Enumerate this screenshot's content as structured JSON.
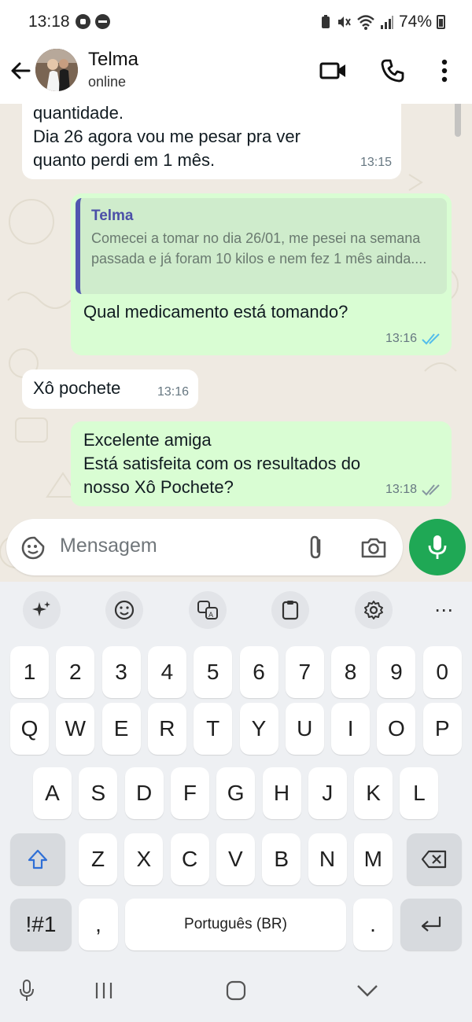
{
  "status_bar": {
    "time": "13:18",
    "battery": "74%"
  },
  "header": {
    "contact_name": "Telma",
    "contact_status": "online"
  },
  "messages": [
    {
      "direction": "in",
      "text": "quantidade.\nDia 26 agora vou me pesar pra ver\nquanto perdi em 1 mês.",
      "time": "13:15"
    },
    {
      "direction": "out",
      "quoted": {
        "name": "Telma",
        "text": "Comecei a tomar no dia 26/01, me pesei na semana passada e já foram 10 kilos e nem fez 1 mês ainda...."
      },
      "text": "Qual medicamento está tomando?",
      "time": "13:16",
      "read": true
    },
    {
      "direction": "in",
      "text": "Xô pochete",
      "time": "13:16"
    },
    {
      "direction": "out",
      "text": "Excelente amiga\nEstá satisfeita com os resultados do\nnosso Xô Pochete?",
      "time": "13:18",
      "read": false
    }
  ],
  "composer": {
    "placeholder": "Mensagem"
  },
  "keyboard": {
    "number_row": [
      "1",
      "2",
      "3",
      "4",
      "5",
      "6",
      "7",
      "8",
      "9",
      "0"
    ],
    "row1": [
      "Q",
      "W",
      "E",
      "R",
      "T",
      "Y",
      "U",
      "I",
      "O",
      "P"
    ],
    "row2": [
      "A",
      "S",
      "D",
      "F",
      "G",
      "H",
      "J",
      "K",
      "L"
    ],
    "row3": [
      "Z",
      "X",
      "C",
      "V",
      "B",
      "N",
      "M"
    ],
    "symbols_key": "!#1",
    "comma_key": ",",
    "space_label": "Português (BR)",
    "period_key": ".",
    "more_label": "⋯"
  },
  "colors": {
    "accent_green": "#1fa855",
    "outgoing_bubble": "#d9fdd3",
    "read_ticks": "#53bdeb"
  }
}
